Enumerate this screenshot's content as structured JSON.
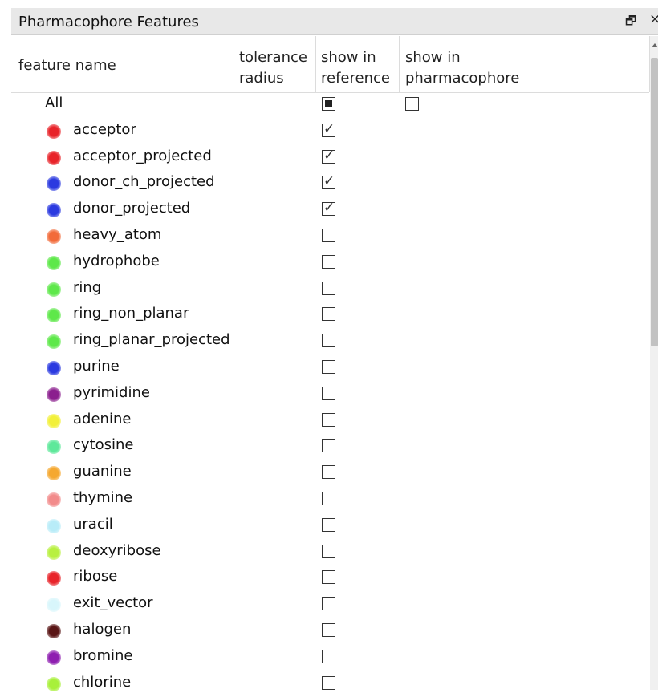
{
  "panel": {
    "title": "Pharmacophore Features",
    "restore_glyph": "🗗",
    "close_glyph": "×"
  },
  "columns": {
    "name": "feature name",
    "tolerance": [
      "tolerance",
      "radius"
    ],
    "reference": [
      "show in",
      "reference"
    ],
    "pharmacophore": [
      "show in",
      "pharmacophore"
    ]
  },
  "all_row": {
    "label": "All",
    "reference_state": "partial",
    "pharmacophore_state": "unchecked"
  },
  "features": [
    {
      "name": "acceptor",
      "color": "#e8242a",
      "reference": true
    },
    {
      "name": "acceptor_projected",
      "color": "#e8242a",
      "reference": true
    },
    {
      "name": "donor_ch_projected",
      "color": "#2b3ae0",
      "reference": true
    },
    {
      "name": "donor_projected",
      "color": "#2b3ae0",
      "reference": true
    },
    {
      "name": "heavy_atom",
      "color": "#f26b3a",
      "reference": false
    },
    {
      "name": "hydrophobe",
      "color": "#5ee84a",
      "reference": false
    },
    {
      "name": "ring",
      "color": "#5ee84a",
      "reference": false
    },
    {
      "name": "ring_non_planar",
      "color": "#5ee84a",
      "reference": false
    },
    {
      "name": "ring_planar_projected",
      "color": "#5ee84a",
      "reference": false
    },
    {
      "name": "purine",
      "color": "#2b3ae0",
      "reference": false
    },
    {
      "name": "pyrimidine",
      "color": "#8b1f8e",
      "reference": false
    },
    {
      "name": "adenine",
      "color": "#f2f03a",
      "reference": false
    },
    {
      "name": "cytosine",
      "color": "#5ee89a",
      "reference": false
    },
    {
      "name": "guanine",
      "color": "#f5a830",
      "reference": false
    },
    {
      "name": "thymine",
      "color": "#f28b8b",
      "reference": false
    },
    {
      "name": "uracil",
      "color": "#b8ecf8",
      "reference": false
    },
    {
      "name": "deoxyribose",
      "color": "#b8f040",
      "reference": false
    },
    {
      "name": "ribose",
      "color": "#e8242a",
      "reference": false
    },
    {
      "name": "exit_vector",
      "color": "#d8f6fb",
      "reference": false
    },
    {
      "name": "halogen",
      "color": "#5a1616",
      "reference": false
    },
    {
      "name": "bromine",
      "color": "#8e1fb0",
      "reference": false
    },
    {
      "name": "chlorine",
      "color": "#a8f03a",
      "reference": false
    }
  ]
}
